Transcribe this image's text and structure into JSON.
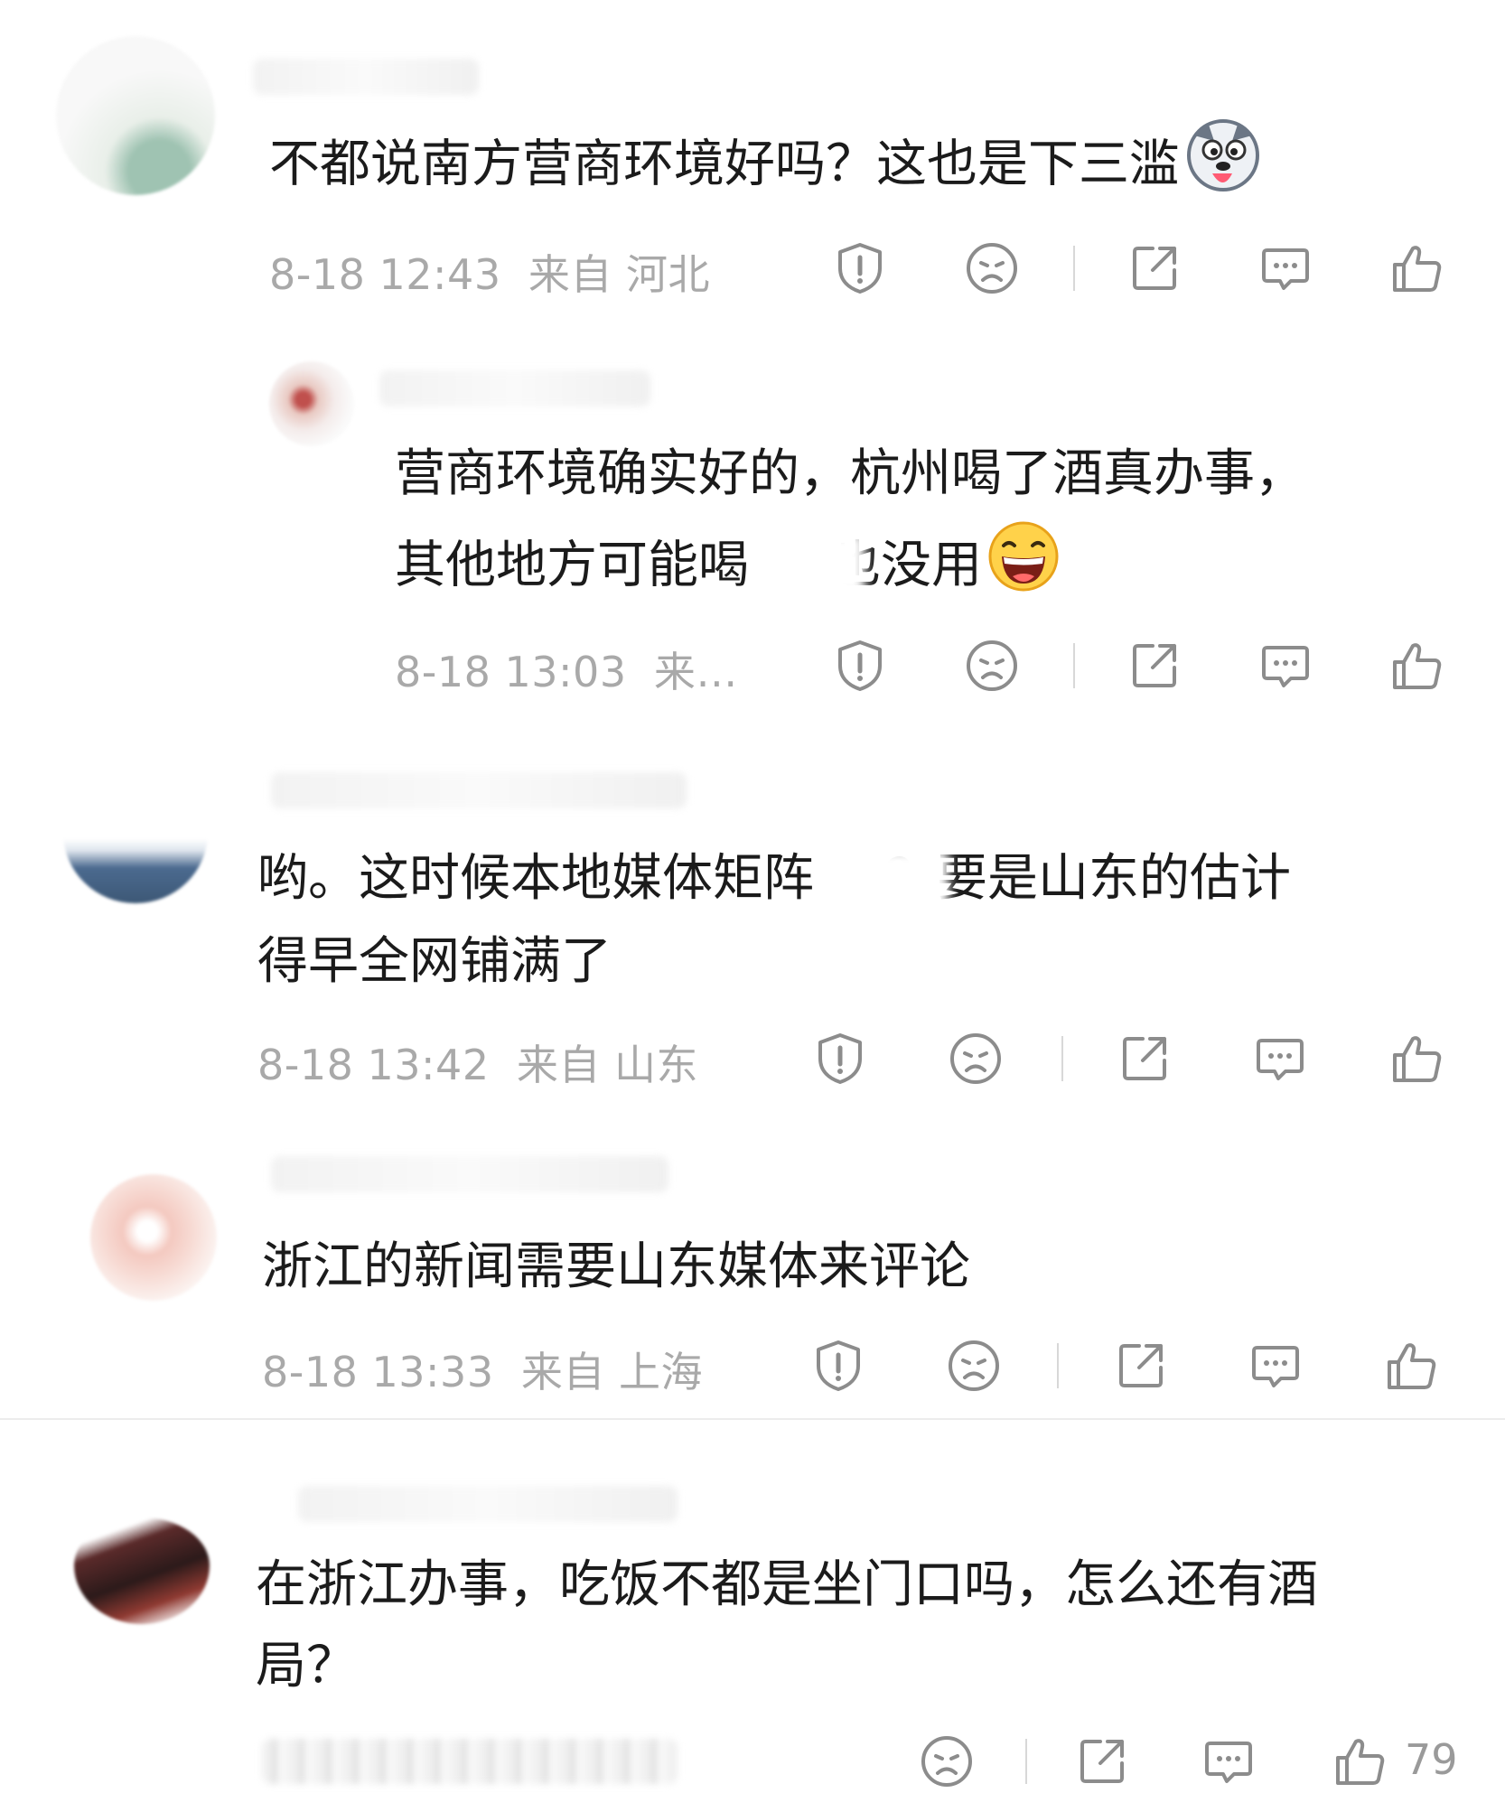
{
  "comments": [
    {
      "text_lines": [
        "不都说南方营商环境好吗？这也是下三滥"
      ],
      "emoji": "husky-emoji",
      "date": "8-18 12:43",
      "location": "来自 河北"
    },
    {
      "text_lines": [
        "营商环境确实好的，杭州喝了酒真办事，",
        "其他地方可能喝",
        "也没用"
      ],
      "emoji": "laughing-emoji",
      "date": "8-18 13:03",
      "location": "来…"
    },
    {
      "text_lines": [
        "哟。这时候本地媒体矩阵",
        "？要是山东的估计",
        "得早全网铺满了"
      ],
      "date": "8-18 13:42",
      "location": "来自 山东"
    },
    {
      "text_lines": [
        "浙江的新闻需要山东媒体来评论"
      ],
      "date": "8-18 13:33",
      "location": "来自 上海"
    },
    {
      "text_lines": [
        "在浙江办事，吃饭不都是坐门口吗，怎么还有酒",
        "局？"
      ],
      "likes": "79"
    }
  ],
  "colors": {
    "text": "#1b1b1b",
    "meta": "#a9a9a9",
    "icon": "#8c8c8c",
    "divider": "#ececec"
  }
}
